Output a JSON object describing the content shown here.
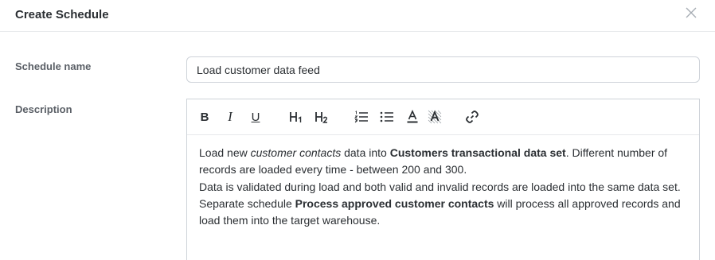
{
  "dialog": {
    "title": "Create Schedule"
  },
  "form": {
    "name_label": "Schedule name",
    "name_value": "Load customer data feed",
    "description_label": "Description"
  },
  "toolbar": {
    "bold": "B",
    "italic": "I",
    "underline": "U",
    "h1": "H1",
    "h2": "H2"
  },
  "description": {
    "p1_a": "Load new ",
    "p1_b": "customer contacts",
    "p1_c": " data into ",
    "p1_d": "Customers transactional data set",
    "p1_e": ". Different number of records are loaded every time - between 200 and 300.",
    "p2": "Data is validated during load and both valid and invalid records are loaded into the same data set.",
    "p3_a": "Separate schedule ",
    "p3_b": "Process approved customer contacts",
    "p3_c": " will process all approved records and load them into the target warehouse."
  }
}
